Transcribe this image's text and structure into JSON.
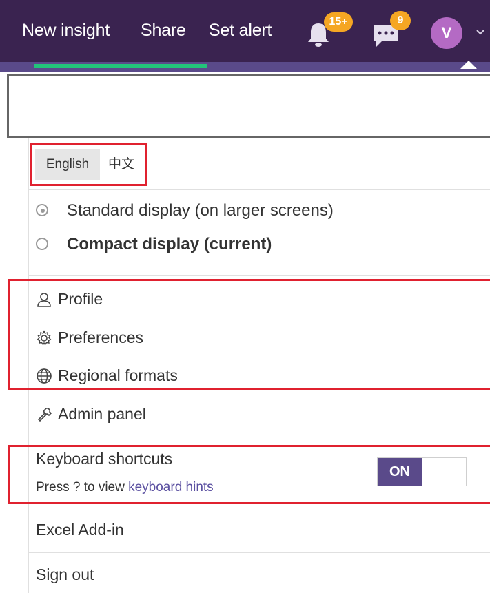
{
  "topbar": {
    "new_insight": "New insight",
    "share": "Share",
    "set_alert": "Set alert",
    "notifications_badge": "15+",
    "messages_badge": "9",
    "avatar_initial": "V",
    "background_color": "#3a2350",
    "badge_color": "#f5a623"
  },
  "search": {
    "placeholder": ""
  },
  "language": {
    "english": "English",
    "chinese": "中文"
  },
  "display": {
    "standard_label": "Standard display (on larger screens)",
    "compact_strong": "Compact display",
    "compact_suffix": " (current)"
  },
  "menu": {
    "profile": "Profile",
    "preferences": "Preferences",
    "regional_formats": "Regional formats",
    "admin_panel": "Admin panel"
  },
  "keyboard": {
    "title": "Keyboard shortcuts",
    "hint_prefix": "Press ? to view ",
    "hint_link": "keyboard hints",
    "toggle_label": "ON"
  },
  "footer": {
    "excel_addin": "Excel Add-in",
    "sign_out": "Sign out"
  },
  "colors": {
    "highlight_border": "#e0212f",
    "toggle_on": "#5a4a8a",
    "progress": "#22c47a",
    "avatar": "#b46ac4"
  }
}
